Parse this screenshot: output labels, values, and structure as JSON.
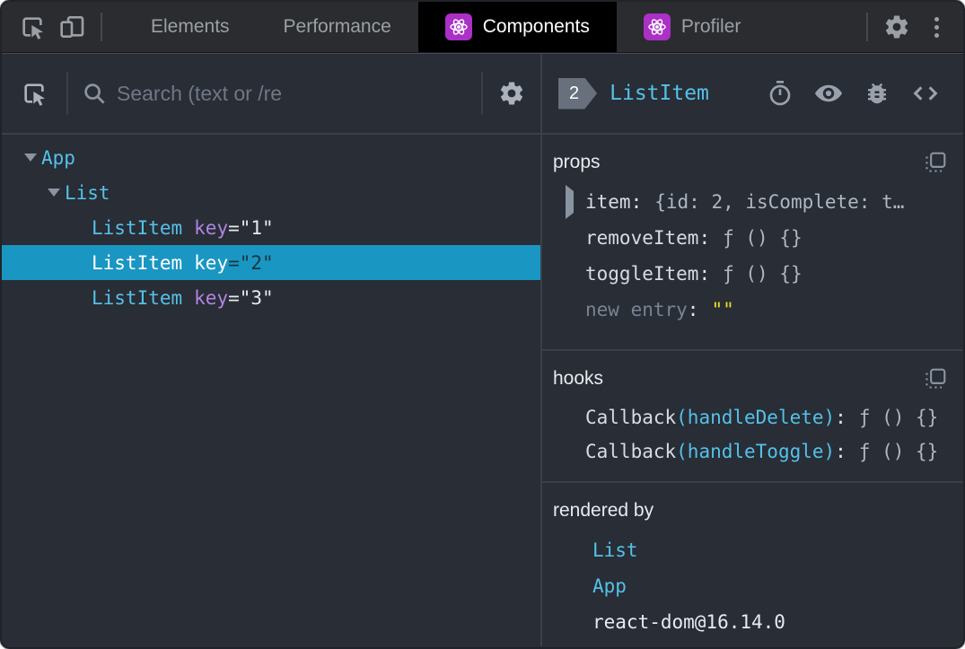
{
  "tabbar": {
    "tabs": [
      {
        "label": "Elements"
      },
      {
        "label": "Performance"
      },
      {
        "label": "Components"
      },
      {
        "label": "Profiler"
      }
    ]
  },
  "left_panel": {
    "search_placeholder": "Search (text or /re",
    "tree": [
      {
        "name": "App"
      },
      {
        "name": "List"
      },
      {
        "name": "ListItem",
        "key_label": "key",
        "key_value": "=\"1\""
      },
      {
        "name": "ListItem",
        "key_label": "key",
        "key_value": "=\"2\""
      },
      {
        "name": "ListItem",
        "key_label": "key",
        "key_value": "=\"3\""
      }
    ]
  },
  "right_panel": {
    "badge": "2",
    "component_name": "ListItem",
    "props": {
      "title": "props",
      "rows": [
        {
          "name": "item",
          "colon": ":",
          "value": "{id: 2, isComplete: t…"
        },
        {
          "name": "removeItem",
          "colon": ":",
          "value": "ƒ () {}"
        },
        {
          "name": "toggleItem",
          "colon": ":",
          "value": "ƒ () {}"
        },
        {
          "name": "new entry",
          "colon": ":",
          "value": "\"\""
        }
      ]
    },
    "hooks": {
      "title": "hooks",
      "rows": [
        {
          "fn": "Callback",
          "arg": "(handleDelete)",
          "colon": ":",
          "value": "ƒ () {}"
        },
        {
          "fn": "Callback",
          "arg": "(handleToggle)",
          "colon": ":",
          "value": "ƒ () {}"
        }
      ]
    },
    "rendered_by": {
      "title": "rendered by",
      "items": [
        {
          "label": "List"
        },
        {
          "label": "App"
        },
        {
          "label": "react-dom@16.14.0"
        }
      ]
    }
  },
  "icons": {
    "tabbar": [
      "inspect-cursor",
      "device-toolbar",
      "react-atom",
      "settings-gear",
      "more-kebab"
    ],
    "left_toolbar": [
      "inspect-cursor",
      "search-magnifier",
      "settings-gear"
    ],
    "right_header": [
      "stopwatch-suspense",
      "eye-inspect-dom",
      "bug-log",
      "code-view-source"
    ],
    "sections": [
      "copy-to-clipboard"
    ]
  },
  "colors": {
    "accent_cyan": "#55c1e8",
    "key_purple": "#b085e0",
    "selected_row_bg": "#1a96c2",
    "string_yellow": "#e8e41c",
    "react_icon_purple": "#aa30c6",
    "panel_bg": "#282d36",
    "tabbar_bg": "#2b2c2f"
  }
}
